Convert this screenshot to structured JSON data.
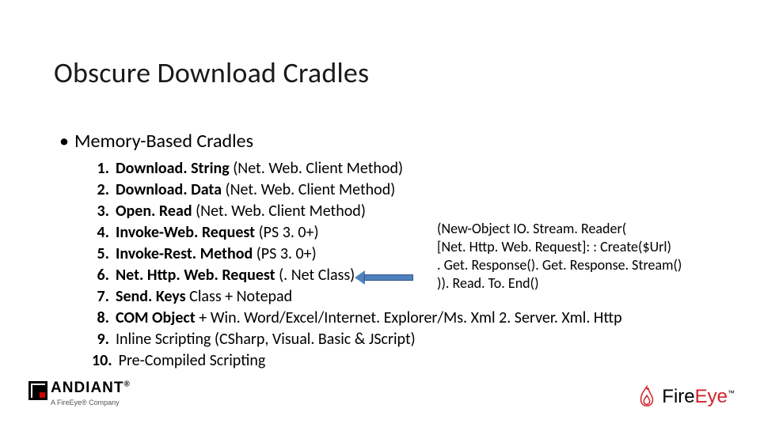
{
  "title": "Obscure Download Cradles",
  "subhead": "Memory-Based Cradles",
  "items": [
    {
      "num": "1.",
      "bold": "Download. String ",
      "rest": "(Net. Web. Client Method)"
    },
    {
      "num": "2.",
      "bold": "Download. Data ",
      "rest": "(Net. Web. Client Method)"
    },
    {
      "num": "3.",
      "bold": "Open. Read ",
      "rest": "(Net. Web. Client Method)"
    },
    {
      "num": "4.",
      "bold": "Invoke-Web. Request ",
      "rest": "(PS 3. 0+)"
    },
    {
      "num": "5.",
      "bold": "Invoke-Rest. Method ",
      "rest": "(PS 3. 0+)"
    },
    {
      "num": "6.",
      "bold": "Net. Http. Web. Request ",
      "rest": "(. Net Class)"
    },
    {
      "num": "7.",
      "bold": "Send. Keys ",
      "rest": "Class + Notepad"
    },
    {
      "num": "8.",
      "bold": "COM Object ",
      "rest": "+ Win. Word/Excel/Internet. Explorer/Ms. Xml 2. Server. Xml. Http"
    },
    {
      "num": "9.",
      "bold": "",
      "rest": "Inline Scripting (CSharp, Visual. Basic & JScript)"
    },
    {
      "num": "10.",
      "bold": "",
      "rest": "Pre-Compiled Scripting"
    }
  ],
  "snippet": {
    "l1": "(New-Object IO. Stream. Reader(",
    "l2": "[Net. Http. Web. Request]: : Create($Url)",
    "l3": ". Get. Response(). Get. Response. Stream()",
    "l4": ")). Read. To. End()"
  },
  "footer": {
    "mandiant_word": "ANDIANT",
    "mandiant_reg": "®",
    "mandiant_sub": "A FireEye® Company",
    "fireeye_fire": "Fire",
    "fireeye_eye": "Eye",
    "fireeye_tm": "™"
  }
}
